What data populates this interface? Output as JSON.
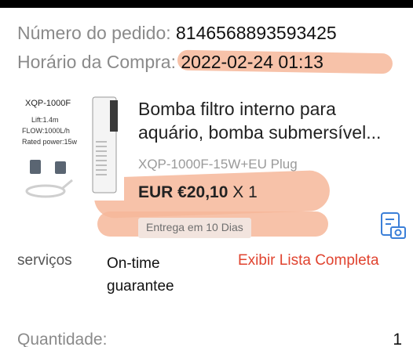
{
  "order": {
    "number_label": "Número do pedido:",
    "number_value": "8146568893593425",
    "time_label": "Horário da Compra:",
    "time_value": "2022-02-24 01:13"
  },
  "product": {
    "image": {
      "model": "XQP-1000F",
      "lift": "Lift:1.4m",
      "flow": "FLOW:1000L/h",
      "power": "Rated power:15w"
    },
    "title": "Bomba filtro interno para aquário, bomba submersível...",
    "variant": "XQP-1000F-15W+EU Plug",
    "price": "EUR €20,10",
    "quantity_text": "X 1",
    "delivery": "Entrega em 10 Dias"
  },
  "services": {
    "label": "serviços",
    "guarantee": "On-time guarantee",
    "view_all": "Exibir Lista Completa"
  },
  "quantity": {
    "label": "Quantidade:",
    "value": "1"
  },
  "colors": {
    "accent": "#e0432f",
    "highlight": "#f6b79a",
    "icon_blue": "#3b7fd8"
  }
}
